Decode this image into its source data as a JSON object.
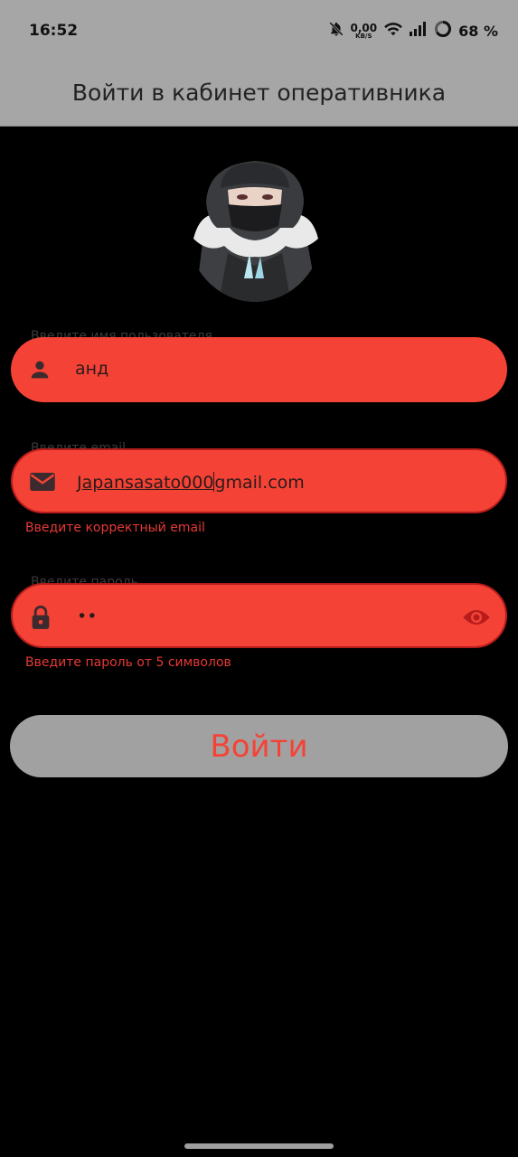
{
  "status_bar": {
    "time": "16:52",
    "net_speed_value": "0,00",
    "net_speed_unit": "KB/S",
    "battery_text": "68 %"
  },
  "app_bar": {
    "title": "Войти в кабинет оперативника"
  },
  "form": {
    "username": {
      "label": "Введите имя пользователя",
      "value": "анд",
      "icon": "person-icon"
    },
    "email": {
      "label": "Введите email",
      "value_before_cursor": "Japansasato000",
      "value_after_cursor": "gmail.com",
      "error": "Введите корректный email",
      "icon": "mail-icon"
    },
    "password": {
      "label": "Введите пароль",
      "value": "••",
      "error": "Введите пароль от 5 символов",
      "icon": "lock-icon",
      "trailing_icon": "eye-icon"
    },
    "submit_label": "Войти"
  },
  "colors": {
    "field_bg": "#f44336",
    "bar_bg": "#a6a6a6",
    "error_text": "#e53935",
    "page_bg": "#000000"
  }
}
